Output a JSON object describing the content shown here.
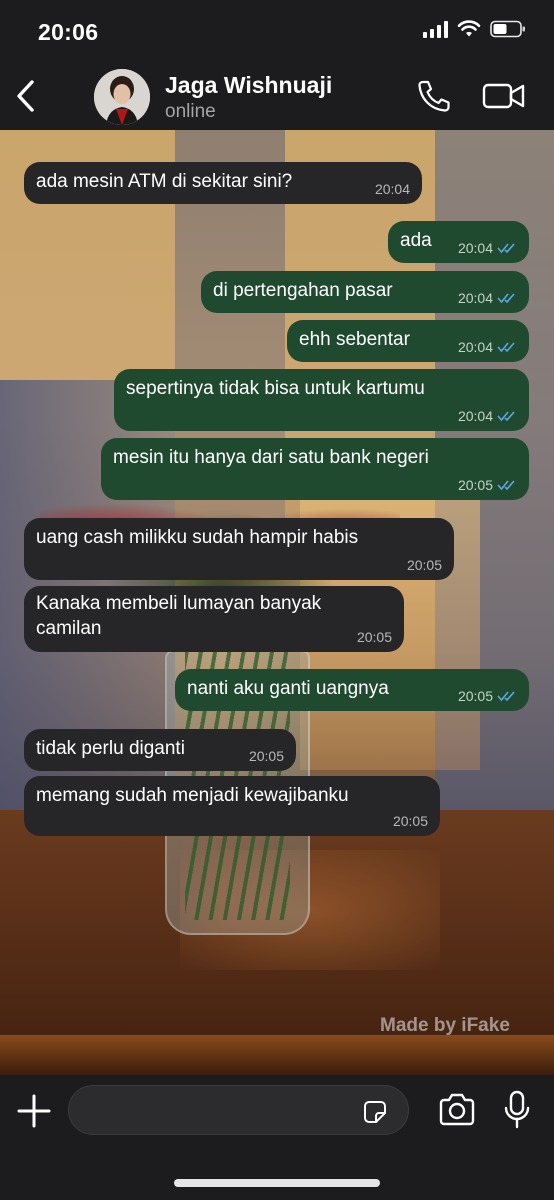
{
  "status_bar": {
    "time": "20:06",
    "signal_icon": "signal-icon",
    "wifi_icon": "wifi-icon",
    "battery_icon": "battery-icon"
  },
  "header": {
    "back_icon": "chevron-left-icon",
    "contact_name": "Jaga Wishnuaji",
    "contact_status": "online",
    "call_icon": "phone-icon",
    "video_icon": "video-camera-icon"
  },
  "colors": {
    "bar_bg": "#1c1c1e",
    "incoming_bubble": "#262629",
    "outgoing_bubble": "#1f4a2f",
    "read_tick": "#5aa8e6"
  },
  "messages": [
    {
      "direction": "in",
      "text": "ada mesin ATM di sekitar sini?",
      "time": "20:04"
    },
    {
      "direction": "out",
      "text": "ada",
      "time": "20:04",
      "status": "read"
    },
    {
      "direction": "out",
      "text": "di pertengahan pasar",
      "time": "20:04",
      "status": "read"
    },
    {
      "direction": "out",
      "text": "ehh sebentar",
      "time": "20:04",
      "status": "read"
    },
    {
      "direction": "out",
      "text": "sepertinya tidak bisa untuk kartumu",
      "time": "20:04",
      "status": "read"
    },
    {
      "direction": "out",
      "text": "mesin itu hanya dari satu bank negeri",
      "time": "20:05",
      "status": "read"
    },
    {
      "direction": "in",
      "text": "uang cash milikku sudah hampir habis",
      "time": "20:05"
    },
    {
      "direction": "in",
      "text_line1": "Kanaka membeli lumayan banyak",
      "text_line2": "camilan",
      "time": "20:05"
    },
    {
      "direction": "out",
      "text": "nanti aku ganti uangnya",
      "time": "20:05",
      "status": "read"
    },
    {
      "direction": "in",
      "text": "tidak perlu diganti",
      "time": "20:05"
    },
    {
      "direction": "in",
      "text": "memang sudah menjadi kewajibanku",
      "time": "20:05"
    }
  ],
  "watermark": "Made by iFake",
  "composer": {
    "input_value": "",
    "input_placeholder": "",
    "plus_icon": "plus-icon",
    "sticker_icon": "sticker-icon",
    "camera_icon": "camera-icon",
    "mic_icon": "microphone-icon"
  }
}
